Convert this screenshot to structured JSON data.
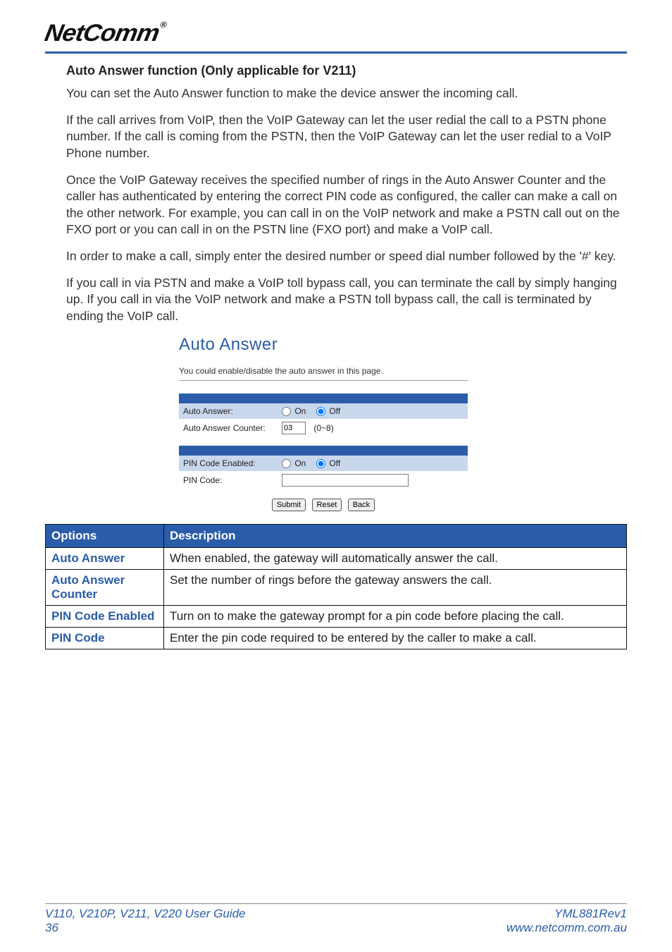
{
  "brand": "NetComm",
  "brand_reg": "®",
  "section_title": "Auto Answer function (Only applicable for V211)",
  "paragraphs": {
    "p1": "You can set the Auto Answer function to make the device answer the incoming call.",
    "p2": "If the call arrives from VoIP, then the VoIP Gateway can let the user redial the call to a PSTN phone number. If the call is coming from the PSTN, then the VoIP Gateway can let the user redial to a VoIP Phone number.",
    "p3": "Once the VoIP Gateway receives the specified number of rings in the Auto Answer Counter and the caller has authenticated by entering the correct PIN code as configured, the caller can make a call on the other network. For example, you can call in on the VoIP network and make a PSTN call out on the FXO port or you can call in on the PSTN line (FXO port) and make a VoIP call.",
    "p4": "In order to make a call, simply enter the desired number or speed dial number followed by the '#' key.",
    "p5": "If you call in via PSTN and make a VoIP toll bypass call, you can terminate the call by simply hanging up. If you call in via the VoIP network and make a PSTN toll bypass call, the call is terminated by ending the VoIP call."
  },
  "ui": {
    "title": "Auto Answer",
    "subtext": "You could enable/disable the auto answer in this page.",
    "labels": {
      "auto_answer": "Auto Answer:",
      "auto_answer_counter": "Auto Answer Counter:",
      "pin_enabled": "PIN Code Enabled:",
      "pin_code": "PIN Code:",
      "on": "On",
      "off": "Off",
      "counter_range": "(0~8)"
    },
    "values": {
      "auto_answer": "off",
      "counter": "03",
      "pin_enabled": "off",
      "pin_code": ""
    },
    "buttons": {
      "submit": "Submit",
      "reset": "Reset",
      "back": "Back"
    }
  },
  "table": {
    "head": {
      "c1": "Options",
      "c2": "Description"
    },
    "rows": [
      {
        "opt": "Auto Answer",
        "desc": "When enabled, the gateway will automatically answer the call."
      },
      {
        "opt": "Auto Answer Counter",
        "desc": "Set the number of rings before the gateway answers the call."
      },
      {
        "opt": "PIN Code Enabled",
        "desc": "Turn on to make the gateway prompt for a pin code before placing the call."
      },
      {
        "opt": "PIN Code",
        "desc": "Enter the pin code required to be entered by the caller to make a call."
      }
    ]
  },
  "footer": {
    "left1": "V110, V210P, V211, V220 User Guide",
    "left2": "36",
    "right1": "YML881Rev1",
    "right2": "www.netcomm.com.au"
  }
}
